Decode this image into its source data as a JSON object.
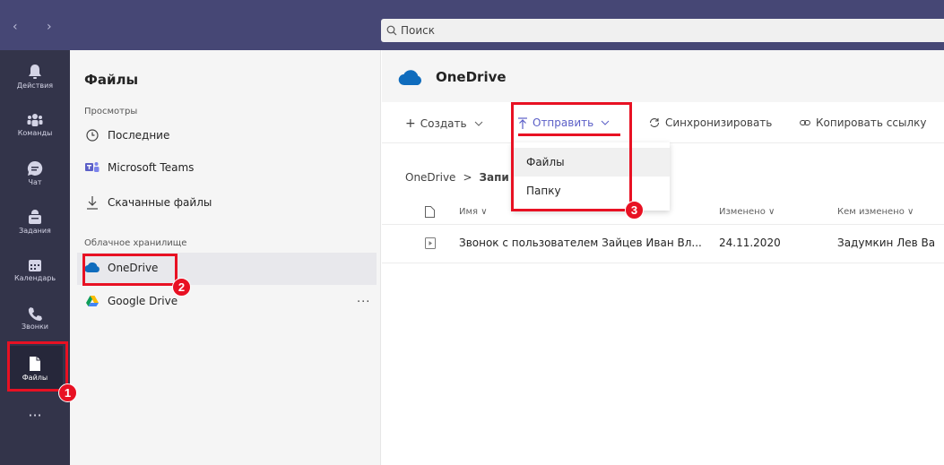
{
  "search": {
    "placeholder": "Поиск"
  },
  "rail": {
    "items": [
      {
        "label": "Действия",
        "icon": "bell-icon"
      },
      {
        "label": "Команды",
        "icon": "teams-icon"
      },
      {
        "label": "Чат",
        "icon": "chat-icon"
      },
      {
        "label": "Задания",
        "icon": "assignments-icon"
      },
      {
        "label": "Календарь",
        "icon": "calendar-icon"
      },
      {
        "label": "Звонки",
        "icon": "phone-icon"
      },
      {
        "label": "Файлы",
        "icon": "file-icon",
        "active": true
      }
    ],
    "more": "···"
  },
  "files_panel": {
    "title": "Файлы",
    "views_label": "Просмотры",
    "views": [
      {
        "label": "Последние",
        "icon": "clock-icon"
      },
      {
        "label": "Microsoft Teams",
        "icon": "teams-logo-icon"
      },
      {
        "label": "Скачанные файлы",
        "icon": "download-icon"
      }
    ],
    "cloud_label": "Облачное хранилище",
    "cloud": [
      {
        "label": "OneDrive",
        "icon": "onedrive-icon",
        "selected": true
      },
      {
        "label": "Google Drive",
        "icon": "google-drive-icon"
      }
    ],
    "more": "···"
  },
  "main": {
    "title": "OneDrive",
    "toolbar": {
      "create": "Создать",
      "send": "Отправить",
      "sync": "Синхронизировать",
      "copy_link": "Копировать ссылку"
    },
    "breadcrumb": {
      "root": "OneDrive",
      "sep": ">",
      "current": "Запи"
    },
    "dropdown": {
      "items": [
        "Файлы",
        "Папку"
      ]
    },
    "columns": {
      "name": "Имя",
      "modified": "Изменено",
      "modified_by": "Кем изменено"
    },
    "rows": [
      {
        "name": "Звонок с пользователем Зайцев Иван Вл...",
        "modified": "24.11.2020",
        "modified_by": "Задумкин Лев Ва"
      }
    ]
  },
  "annotations": [
    "1",
    "2",
    "3"
  ],
  "colors": {
    "accent": "#5b5fc7",
    "highlight": "#e81123",
    "topbar": "#464775",
    "rail": "#33344a"
  }
}
